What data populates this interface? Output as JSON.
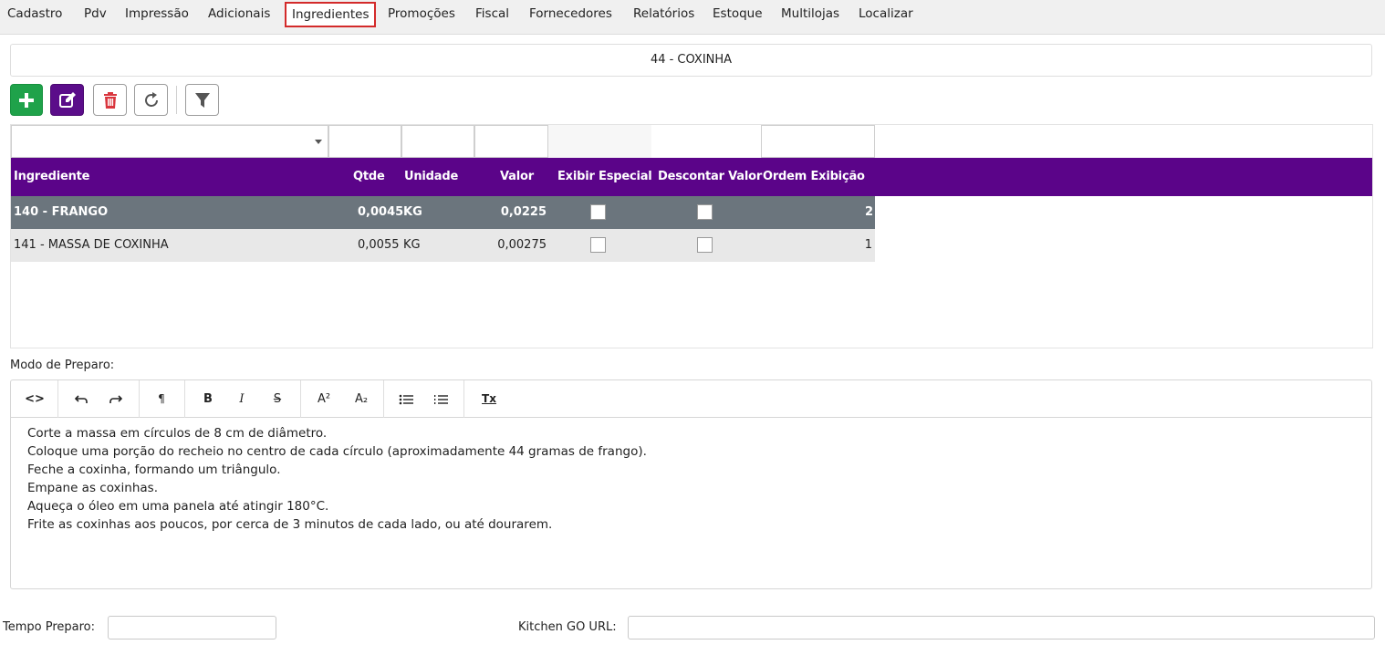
{
  "tabs": [
    {
      "label": "Cadastro"
    },
    {
      "label": "Pdv"
    },
    {
      "label": "Impressão"
    },
    {
      "label": "Adicionais"
    },
    {
      "label": "Ingredientes"
    },
    {
      "label": "Promoções"
    },
    {
      "label": "Fiscal"
    },
    {
      "label": "Fornecedores"
    },
    {
      "label": "Relatórios"
    },
    {
      "label": "Estoque"
    },
    {
      "label": "Multilojas"
    },
    {
      "label": "Localizar"
    }
  ],
  "active_tab": "Ingredientes",
  "product_title": "44 - COXINHA",
  "toolbar": {
    "add": "plus-icon",
    "edit": "edit-icon",
    "delete": "trash-icon",
    "refresh": "refresh-icon",
    "filter": "filter-icon"
  },
  "colors": {
    "header_bg": "#5b0489",
    "selected_row": "#6b757d",
    "add_button": "#1fa24a",
    "edit_button": "#5b0d8a",
    "delete_icon": "#d9363e",
    "active_tab_border": "#d32a2a"
  },
  "grid": {
    "columns": [
      "Ingrediente",
      "Qtde",
      "Unidade",
      "Valor",
      "Exibir Especial",
      "Descontar Valor",
      "Ordem Exibição"
    ],
    "rows": [
      {
        "ingrediente": "140 - FRANGO",
        "qtde": "0,0045",
        "unidade": "KG",
        "valor": "0,0225",
        "exibir_especial": false,
        "descontar_valor": false,
        "ordem": "2",
        "selected": true
      },
      {
        "ingrediente": "141 - MASSA DE COXINHA",
        "qtde": "0,0055",
        "unidade": "KG",
        "valor": "0,00275",
        "exibir_especial": false,
        "descontar_valor": false,
        "ordem": "1",
        "selected": false
      }
    ]
  },
  "modo_preparo": {
    "label": "Modo de Preparo:",
    "toolbar": {
      "code": "<>",
      "undo": "undo-icon",
      "redo": "redo-icon",
      "paragraph": "¶",
      "bold": "B",
      "italic": "I",
      "strike": "S",
      "superscript": "A²",
      "subscript": "A₂",
      "bullet_list": "bullet-list-icon",
      "numbered_list": "numbered-list-icon",
      "clear_format": "Tx"
    },
    "lines": [
      "Corte a massa em círculos de 8 cm de diâmetro.",
      "Coloque uma porção do recheio no centro de cada círculo (aproximadamente 44 gramas de frango).",
      "Feche a coxinha, formando um triângulo.",
      "Empane as coxinhas.",
      "Aqueça o óleo em uma panela até atingir 180°C.",
      "Frite as coxinhas aos poucos, por cerca de 3 minutos de cada lado, ou até dourarem."
    ]
  },
  "tempo_preparo": {
    "label": "Tempo Preparo:",
    "value": ""
  },
  "kitchen_url": {
    "label": "Kitchen GO URL:",
    "value": ""
  }
}
